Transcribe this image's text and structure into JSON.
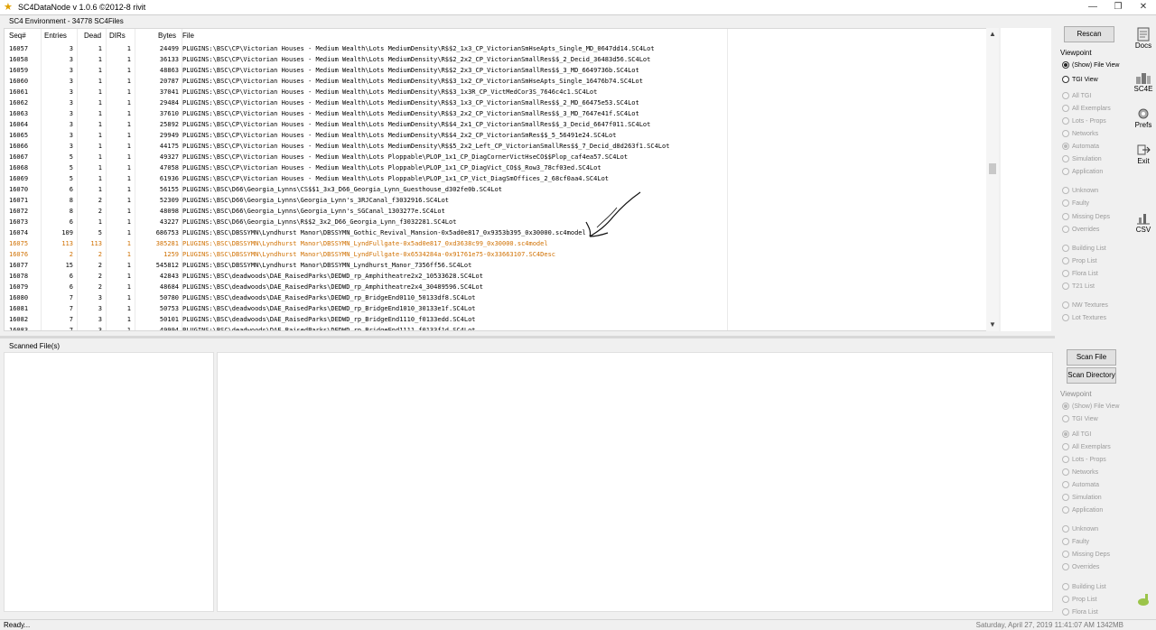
{
  "window": {
    "title": "SC4DataNode v 1.0.6 ©2012-8 rivit",
    "controls": [
      "—",
      "❐",
      "✕"
    ]
  },
  "environment_label": "SC4 Environment - 34778 SC4Files",
  "table": {
    "columns": [
      "Seq#",
      "Entries",
      "Dead",
      "DIRs",
      "Bytes",
      "File"
    ],
    "rows": [
      {
        "seq": "16057",
        "entries": "3",
        "dead": "1",
        "dirs": "1",
        "bytes": "24499",
        "file": "PLUGINS:\\BSC\\CP\\Victorian Houses - Medium Wealth\\Lots MediumDensity\\R$$2_1x3_CP_VictorianSmHseApts_Single_MD_0647dd14.SC4Lot",
        "highlight": false
      },
      {
        "seq": "16058",
        "entries": "3",
        "dead": "1",
        "dirs": "1",
        "bytes": "36133",
        "file": "PLUGINS:\\BSC\\CP\\Victorian Houses - Medium Wealth\\Lots MediumDensity\\R$$2_2x2_CP_VictorianSmallRes$$_2_Decid_36483d56.SC4Lot",
        "highlight": false
      },
      {
        "seq": "16059",
        "entries": "3",
        "dead": "1",
        "dirs": "1",
        "bytes": "48863",
        "file": "PLUGINS:\\BSC\\CP\\Victorian Houses - Medium Wealth\\Lots MediumDensity\\R$$2_2x3_CP_VictorianSmallRes$$_3_MD_6649736b.SC4Lot",
        "highlight": false
      },
      {
        "seq": "16060",
        "entries": "3",
        "dead": "1",
        "dirs": "1",
        "bytes": "20787",
        "file": "PLUGINS:\\BSC\\CP\\Victorian Houses - Medium Wealth\\Lots MediumDensity\\R$$3_1x2_CP_VictorianSmHseApts_Single_16476b74.SC4Lot",
        "highlight": false
      },
      {
        "seq": "16061",
        "entries": "3",
        "dead": "1",
        "dirs": "1",
        "bytes": "37041",
        "file": "PLUGINS:\\BSC\\CP\\Victorian Houses - Medium Wealth\\Lots MediumDensity\\R$$3_1x3R_CP_VictMedCor3S_7646c4c1.SC4Lot",
        "highlight": false
      },
      {
        "seq": "16062",
        "entries": "3",
        "dead": "1",
        "dirs": "1",
        "bytes": "29484",
        "file": "PLUGINS:\\BSC\\CP\\Victorian Houses - Medium Wealth\\Lots MediumDensity\\R$$3_1x3_CP_VictorianSmallRes$$_2_MD_66475e53.SC4Lot",
        "highlight": false
      },
      {
        "seq": "16063",
        "entries": "3",
        "dead": "1",
        "dirs": "1",
        "bytes": "37610",
        "file": "PLUGINS:\\BSC\\CP\\Victorian Houses - Medium Wealth\\Lots MediumDensity\\R$$3_2x2_CP_VictorianSmallRes$$_3_MD_7647e41f.SC4Lot",
        "highlight": false
      },
      {
        "seq": "16064",
        "entries": "3",
        "dead": "1",
        "dirs": "1",
        "bytes": "25892",
        "file": "PLUGINS:\\BSC\\CP\\Victorian Houses - Medium Wealth\\Lots MediumDensity\\R$$4_2x1_CP_VictorianSmallRes$$_3_Decid_6647f011.SC4Lot",
        "highlight": false
      },
      {
        "seq": "16065",
        "entries": "3",
        "dead": "1",
        "dirs": "1",
        "bytes": "29949",
        "file": "PLUGINS:\\BSC\\CP\\Victorian Houses - Medium Wealth\\Lots MediumDensity\\R$$4_2x2_CP_VictorianSmRes$$_5_56491e24.SC4Lot",
        "highlight": false
      },
      {
        "seq": "16066",
        "entries": "3",
        "dead": "1",
        "dirs": "1",
        "bytes": "44175",
        "file": "PLUGINS:\\BSC\\CP\\Victorian Houses - Medium Wealth\\Lots MediumDensity\\R$$5_2x2_Left_CP_VictorianSmallRes$$_7_Decid_d8d263f1.SC4Lot",
        "highlight": false
      },
      {
        "seq": "16067",
        "entries": "5",
        "dead": "1",
        "dirs": "1",
        "bytes": "49327",
        "file": "PLUGINS:\\BSC\\CP\\Victorian Houses - Medium Wealth\\Lots Ploppable\\PLOP_1x1_CP_DiagCornerVictHseCO$$Plop_caf4ea57.SC4Lot",
        "highlight": false
      },
      {
        "seq": "16068",
        "entries": "5",
        "dead": "1",
        "dirs": "1",
        "bytes": "47058",
        "file": "PLUGINS:\\BSC\\CP\\Victorian Houses - Medium Wealth\\Lots Ploppable\\PLOP_1x1_CP_DiagVict_CO$$_Row3_78cf03ed.SC4Lot",
        "highlight": false
      },
      {
        "seq": "16069",
        "entries": "5",
        "dead": "1",
        "dirs": "1",
        "bytes": "61936",
        "file": "PLUGINS:\\BSC\\CP\\Victorian Houses - Medium Wealth\\Lots Ploppable\\PLOP_1x1_CP_Vict_DiagSmOffices_2_68cf0aa4.SC4Lot",
        "highlight": false
      },
      {
        "seq": "16070",
        "entries": "6",
        "dead": "1",
        "dirs": "1",
        "bytes": "56155",
        "file": "PLUGINS:\\BSC\\D66\\Georgia_Lynns\\CS$$1_3x3_D66_Georgia_Lynn_Guesthouse_d302fe0b.SC4Lot",
        "highlight": false
      },
      {
        "seq": "16071",
        "entries": "8",
        "dead": "2",
        "dirs": "1",
        "bytes": "52309",
        "file": "PLUGINS:\\BSC\\D66\\Georgia_Lynns\\Georgia_Lynn's_3RJCanal_f3032916.SC4Lot",
        "highlight": false
      },
      {
        "seq": "16072",
        "entries": "8",
        "dead": "2",
        "dirs": "1",
        "bytes": "48098",
        "file": "PLUGINS:\\BSC\\D66\\Georgia_Lynns\\Georgia_Lynn's_SGCanal_1303277e.SC4Lot",
        "highlight": false
      },
      {
        "seq": "16073",
        "entries": "6",
        "dead": "1",
        "dirs": "1",
        "bytes": "43227",
        "file": "PLUGINS:\\BSC\\D66\\Georgia_Lynns\\R$$2_3x2_D66_Georgia_Lynn_f3032281.SC4Lot",
        "highlight": false
      },
      {
        "seq": "16074",
        "entries": "109",
        "dead": "5",
        "dirs": "1",
        "bytes": "686753",
        "file": "PLUGINS:\\BSC\\DBSSYMN\\Lyndhurst Manor\\DBSSYMN_Gothic_Revival_Mansion-0x5ad0e817_0x9353b395_0x30000.sc4model",
        "highlight": false
      },
      {
        "seq": "16075",
        "entries": "113",
        "dead": "113",
        "dirs": "1",
        "bytes": "385281",
        "file": "PLUGINS:\\BSC\\DBSSYMN\\Lyndhurst Manor\\DBSSYMN_LyndFullgate-0x5ad0e817_0xd3638c99_0x30000.sc4model",
        "highlight": true
      },
      {
        "seq": "16076",
        "entries": "2",
        "dead": "2",
        "dirs": "1",
        "bytes": "1259",
        "file": "PLUGINS:\\BSC\\DBSSYMN\\Lyndhurst Manor\\DBSSYMN_LyndFullgate-0x6534284a-0x91761e75-0x33663107.SC4Desc",
        "highlight": true
      },
      {
        "seq": "16077",
        "entries": "15",
        "dead": "2",
        "dirs": "1",
        "bytes": "545812",
        "file": "PLUGINS:\\BSC\\DBSSYMN\\Lyndhurst Manor\\DBSSYMN_Lyndhurst_Manor_7356ff56.SC4Lot",
        "highlight": false
      },
      {
        "seq": "16078",
        "entries": "6",
        "dead": "2",
        "dirs": "1",
        "bytes": "42843",
        "file": "PLUGINS:\\BSC\\deadwoods\\DAE_RaisedParks\\DEDWD_rp_Amphitheatre2x2_10533628.SC4Lot",
        "highlight": false
      },
      {
        "seq": "16079",
        "entries": "6",
        "dead": "2",
        "dirs": "1",
        "bytes": "48684",
        "file": "PLUGINS:\\BSC\\deadwoods\\DAE_RaisedParks\\DEDWD_rp_Amphitheatre2x4_30489596.SC4Lot",
        "highlight": false
      },
      {
        "seq": "16080",
        "entries": "7",
        "dead": "3",
        "dirs": "1",
        "bytes": "50780",
        "file": "PLUGINS:\\BSC\\deadwoods\\DAE_RaisedParks\\DEDWD_rp_BridgeEnd0110_50133df8.SC4Lot",
        "highlight": false
      },
      {
        "seq": "16081",
        "entries": "7",
        "dead": "3",
        "dirs": "1",
        "bytes": "50753",
        "file": "PLUGINS:\\BSC\\deadwoods\\DAE_RaisedParks\\DEDWD_rp_BridgeEnd1010_30133e1f.SC4Lot",
        "highlight": false
      },
      {
        "seq": "16082",
        "entries": "7",
        "dead": "3",
        "dirs": "1",
        "bytes": "50101",
        "file": "PLUGINS:\\BSC\\deadwoods\\DAE_RaisedParks\\DEDWD_rp_BridgeEnd1110_f0133edd.SC4Lot",
        "highlight": false
      },
      {
        "seq": "16083",
        "entries": "7",
        "dead": "3",
        "dirs": "1",
        "bytes": "49994",
        "file": "PLUGINS:\\BSC\\deadwoods\\DAE_RaisedParks\\DEDWD_rp_BridgeEnd1111_f0133f1d.SC4Lot",
        "highlight": false
      }
    ]
  },
  "top_controls": {
    "rescan_label": "Rescan",
    "viewpoint_label": "Viewpoint",
    "view_options": [
      {
        "label": "(Show) File View",
        "selected": true,
        "enabled": true
      },
      {
        "label": "TGI View",
        "selected": false,
        "enabled": true
      }
    ],
    "filter_options": [
      {
        "label": "All TGI",
        "selected": false
      },
      {
        "label": "All Exemplars",
        "selected": false
      },
      {
        "label": "Lots - Props",
        "selected": false
      },
      {
        "label": "Networks",
        "selected": false
      },
      {
        "label": "Automata",
        "selected": true
      },
      {
        "label": "Simulation",
        "selected": false
      },
      {
        "label": "Application",
        "selected": false
      },
      {
        "label": "Unknown",
        "selected": false
      },
      {
        "label": "Faulty",
        "selected": false
      },
      {
        "label": "Missing Deps",
        "selected": false
      },
      {
        "label": "Overrides",
        "selected": false
      },
      {
        "label": "Building List",
        "selected": false
      },
      {
        "label": "Prop List",
        "selected": false
      },
      {
        "label": "Flora List",
        "selected": false
      },
      {
        "label": "T21 List",
        "selected": false
      },
      {
        "label": "NW Textures",
        "selected": false
      },
      {
        "label": "Lot Textures",
        "selected": false
      }
    ]
  },
  "toolbar": {
    "docs": "Docs",
    "sc4e": "SC4E",
    "prefs": "Prefs",
    "exit": "Exit",
    "csv": "CSV"
  },
  "bottom": {
    "scanned_label": "Scanned File(s)",
    "scan_file_label": "Scan File",
    "scan_dir_label": "Scan Directory",
    "viewpoint_label": "Viewpoint",
    "view_options": [
      {
        "label": "(Show) File View",
        "selected": true
      },
      {
        "label": "TGI View",
        "selected": false
      }
    ],
    "filter_options": [
      {
        "label": "All TGI",
        "selected": true
      },
      {
        "label": "All Exemplars",
        "selected": false
      },
      {
        "label": "Lots - Props",
        "selected": false
      },
      {
        "label": "Networks",
        "selected": false
      },
      {
        "label": "Automata",
        "selected": false
      },
      {
        "label": "Simulation",
        "selected": false
      },
      {
        "label": "Application",
        "selected": false
      },
      {
        "label": "Unknown",
        "selected": false
      },
      {
        "label": "Faulty",
        "selected": false
      },
      {
        "label": "Missing Deps",
        "selected": false
      },
      {
        "label": "Overrides",
        "selected": false
      },
      {
        "label": "Building List",
        "selected": false
      },
      {
        "label": "Prop List",
        "selected": false
      },
      {
        "label": "Flora List",
        "selected": false
      }
    ]
  },
  "status": {
    "left": "Ready...",
    "right": "Saturday, April 27, 2019 11:41:07 AM   1342MB"
  },
  "colors": {
    "highlight_row": "#d07000",
    "disabled_text": "#9a9a9a"
  }
}
